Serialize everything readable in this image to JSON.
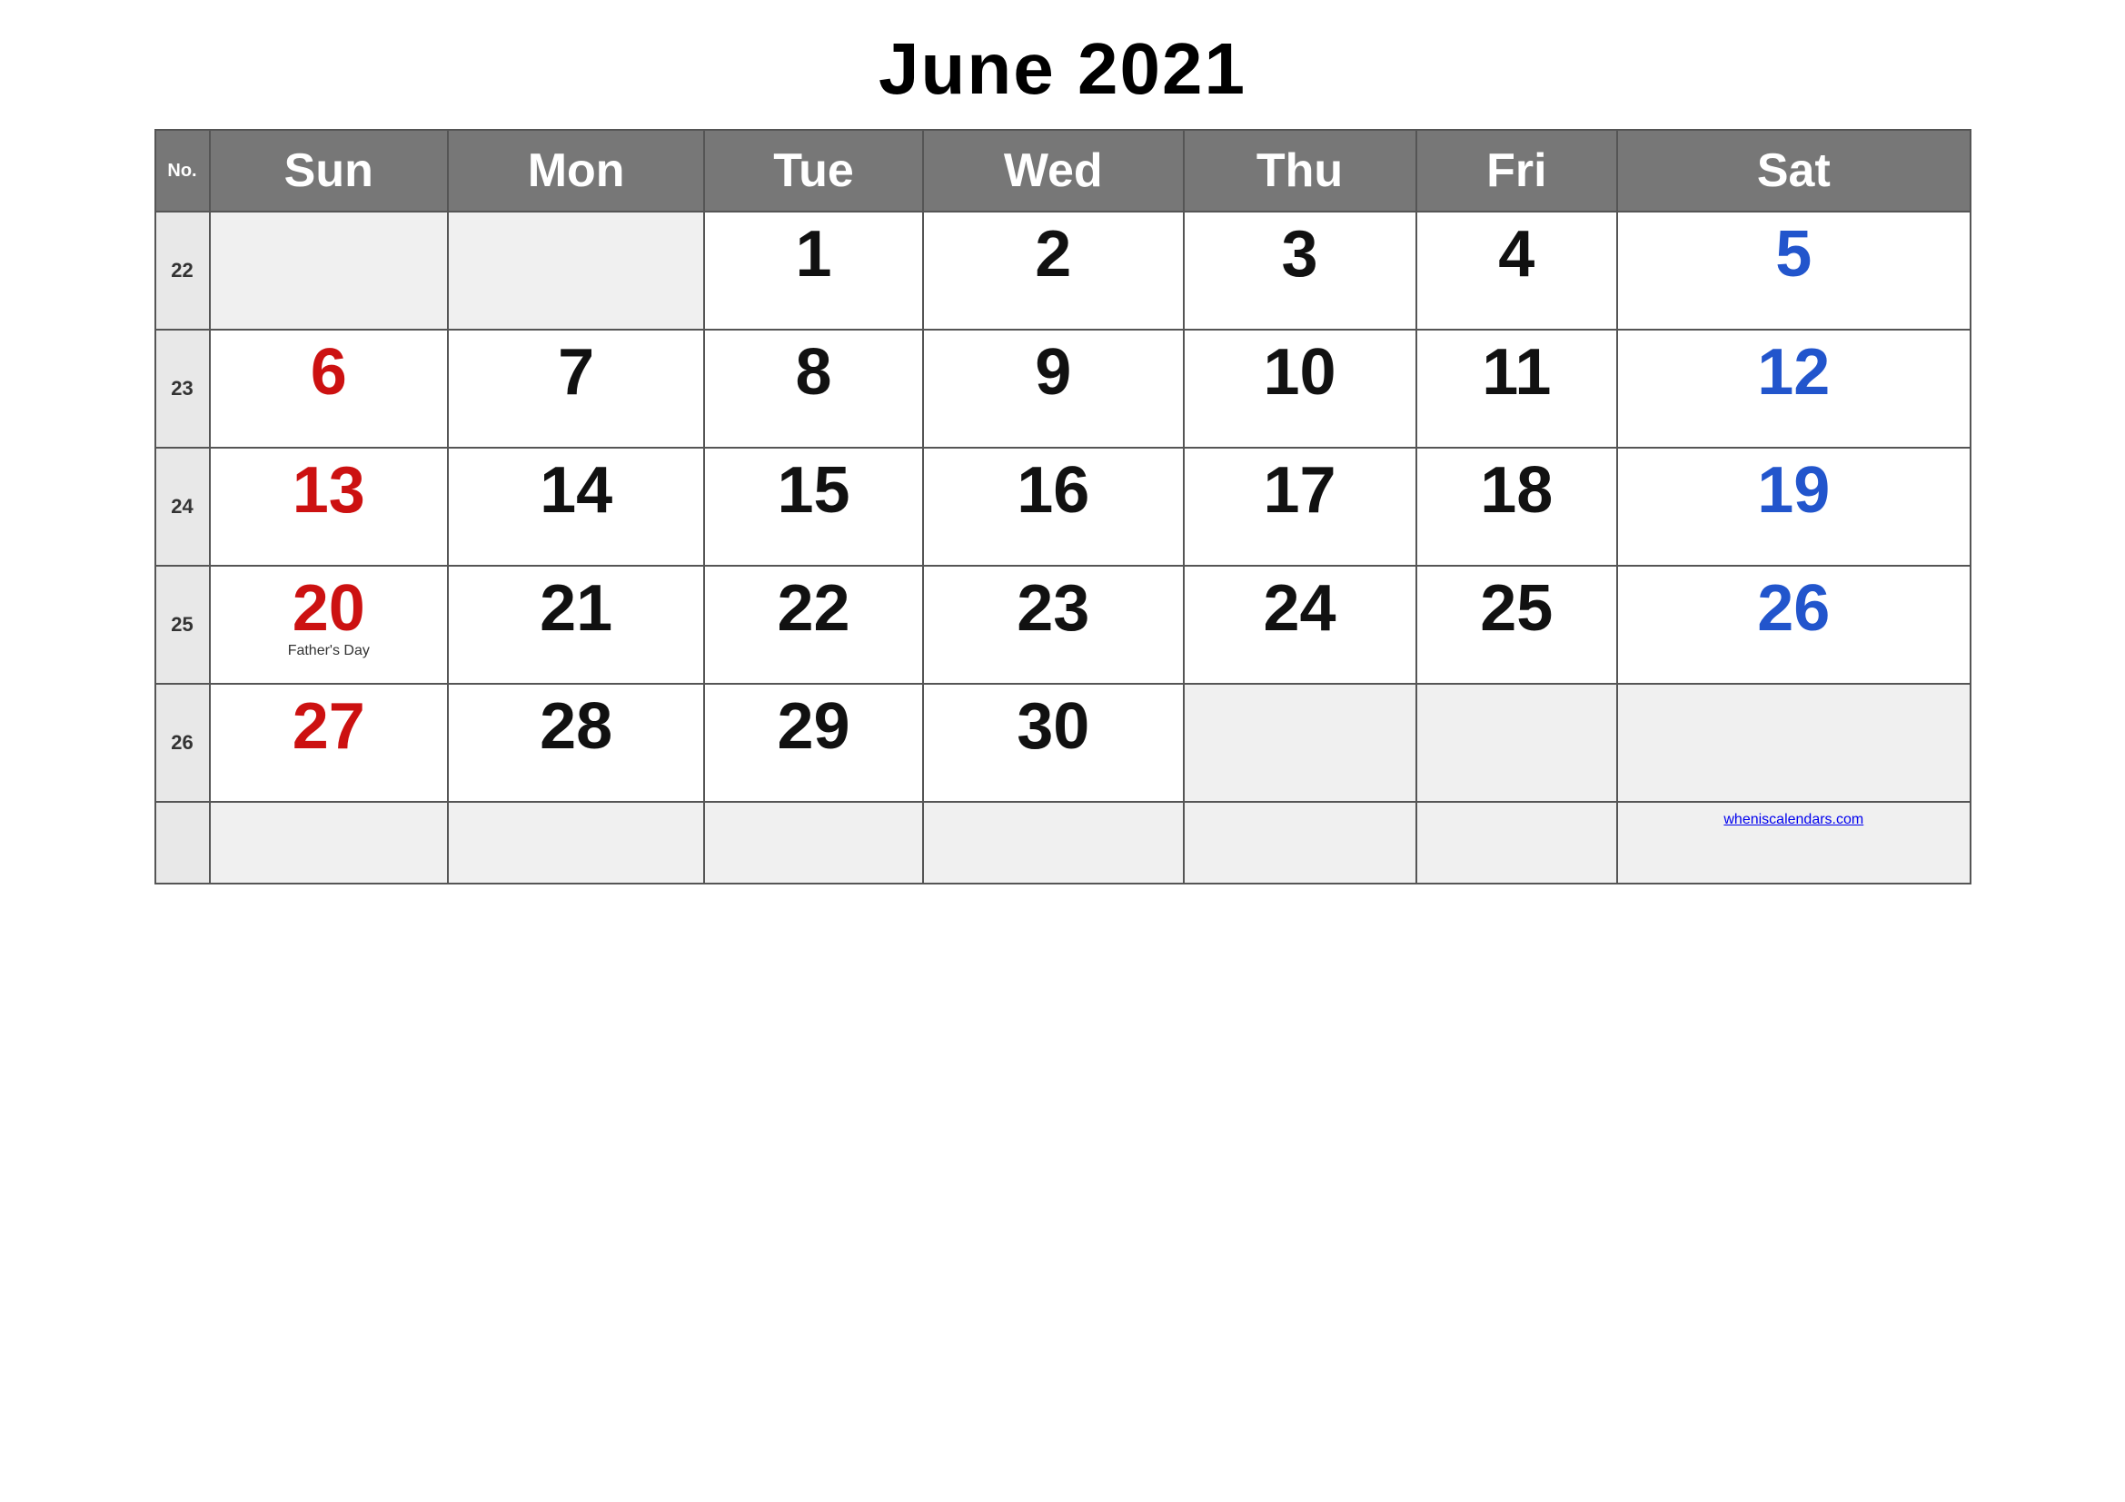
{
  "title": "June 2021",
  "header": {
    "no_label": "No.",
    "days": [
      "Sun",
      "Mon",
      "Tue",
      "Wed",
      "Thu",
      "Fri",
      "Sat"
    ]
  },
  "weeks": [
    {
      "week_num": "22",
      "days": [
        {
          "num": "",
          "color": "empty"
        },
        {
          "num": "",
          "color": "empty"
        },
        {
          "num": "1",
          "color": "black"
        },
        {
          "num": "2",
          "color": "black"
        },
        {
          "num": "3",
          "color": "black"
        },
        {
          "num": "4",
          "color": "black"
        },
        {
          "num": "5",
          "color": "blue"
        }
      ]
    },
    {
      "week_num": "23",
      "days": [
        {
          "num": "6",
          "color": "red"
        },
        {
          "num": "7",
          "color": "black"
        },
        {
          "num": "8",
          "color": "black"
        },
        {
          "num": "9",
          "color": "black"
        },
        {
          "num": "10",
          "color": "black"
        },
        {
          "num": "11",
          "color": "black"
        },
        {
          "num": "12",
          "color": "blue"
        }
      ]
    },
    {
      "week_num": "24",
      "days": [
        {
          "num": "13",
          "color": "red"
        },
        {
          "num": "14",
          "color": "black"
        },
        {
          "num": "15",
          "color": "black"
        },
        {
          "num": "16",
          "color": "black"
        },
        {
          "num": "17",
          "color": "black"
        },
        {
          "num": "18",
          "color": "black"
        },
        {
          "num": "19",
          "color": "blue"
        }
      ]
    },
    {
      "week_num": "25",
      "days": [
        {
          "num": "20",
          "color": "red",
          "holiday": "Father's Day"
        },
        {
          "num": "21",
          "color": "black"
        },
        {
          "num": "22",
          "color": "black"
        },
        {
          "num": "23",
          "color": "black"
        },
        {
          "num": "24",
          "color": "black"
        },
        {
          "num": "25",
          "color": "black"
        },
        {
          "num": "26",
          "color": "blue"
        }
      ]
    },
    {
      "week_num": "26",
      "days": [
        {
          "num": "27",
          "color": "red"
        },
        {
          "num": "28",
          "color": "black"
        },
        {
          "num": "29",
          "color": "black"
        },
        {
          "num": "30",
          "color": "black"
        },
        {
          "num": "",
          "color": "empty"
        },
        {
          "num": "",
          "color": "empty"
        },
        {
          "num": "",
          "color": "empty"
        }
      ]
    }
  ],
  "extra_row": {
    "week_num": "",
    "days": [
      "",
      "",
      "",
      "",
      "",
      "",
      ""
    ]
  },
  "watermark": {
    "text": "wheniscalendars.com",
    "url": "#"
  }
}
